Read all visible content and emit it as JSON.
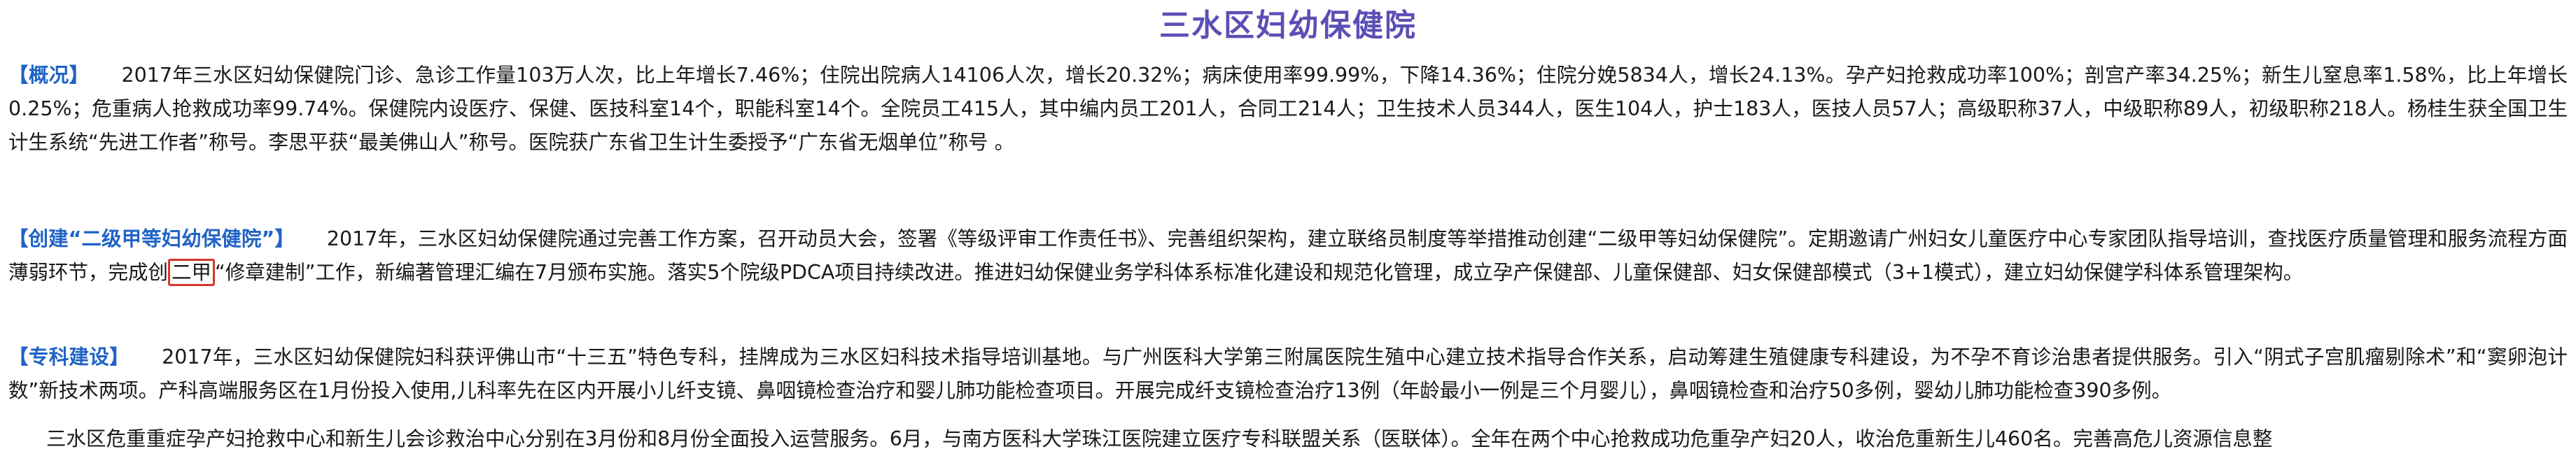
{
  "document": {
    "title": "三水区妇幼保健院",
    "sections": [
      {
        "heading": "【概况】",
        "body": "2017年三水区妇幼保健院门诊、急诊工作量103万人次，比上年增长7.46%；住院出院病人14106人次，增长20.32%；病床使用率99.99%，下降14.36%；住院分娩5834人，增长24.13%。孕产妇抢救成功率100%；剖宫产率34.25%；新生儿窒息率1.58%，比上年增长0.25%；危重病人抢救成功率99.74%。保健院内设医疗、保健、医技科室14个，职能科室14个。全院员工415人，其中编内员工201人，合同工214人；卫生技术人员344人，医生104人，护士183人，医技人员57人；高级职称37人，中级职称89人，初级职称218人。杨桂生获全国卫生计生系统“先进工作者”称号。李思平获“最美佛山人”称号。医院获广东省卫生计生委授予“广东省无烟单位”称号 。"
      },
      {
        "heading": "【创建“二级甲等妇幼保健院”】",
        "body_before": "2017年，三水区妇幼保健院通过完善工作方案，召开动员大会，签署《等级评审工作责任书》、完善组织架构，建立联络员制度等举措推动创建“二级甲等妇幼保健院”。定期邀请广州妇女儿童医疗中心专家团队指导培训，查找医疗质量管理和服务流程方面薄弱环节，完成创",
        "highlight": "二甲",
        "body_after": "“修章建制”工作，新编著管理汇编在7月颁布实施。落实5个院级PDCA项目持续改进。推进妇幼保健业务学科体系标准化建设和规范化管理，成立孕产保健部、儿童保健部、妇女保健部模式（3+1模式），建立妇幼保健学科体系管理架构。"
      },
      {
        "heading": "【专科建设】",
        "body": "2017年，三水区妇幼保健院妇科获评佛山市“十三五”特色专科，挂牌成为三水区妇科技术指导培训基地。与广州医科大学第三附属医院生殖中心建立技术指导合作关系，启动筹建生殖健康专科建设，为不孕不育诊治患者提供服务。引入“阴式子宫肌瘤剔除术”和“窦卵泡计数”新技术两项。产科高端服务区在1月份投入使用,儿科率先在区内开展小儿纤支镜、鼻咽镜检查治疗和婴儿肺功能检查项目。开展完成纤支镜检查治疗13例（年龄最小一例是三个月婴儿），鼻咽镜检查和治疗50多例，婴幼儿肺功能检查390多例。"
      },
      {
        "body": "三水区危重重症孕产妇抢救中心和新生儿会诊救治中心分别在3月份和8月份全面投入运营服务。6月，与南方医科大学珠江医院建立医疗专科联盟关系（医联体）。全年在两个中心抢救成功危重孕产妇20人，收治危重新生儿460名。完善高危儿资源信息整"
      }
    ],
    "colors": {
      "title": "#5b4fb5",
      "heading": "#1f63c6",
      "highlight_border": "#d9352b",
      "text": "#1a1a1a"
    }
  }
}
